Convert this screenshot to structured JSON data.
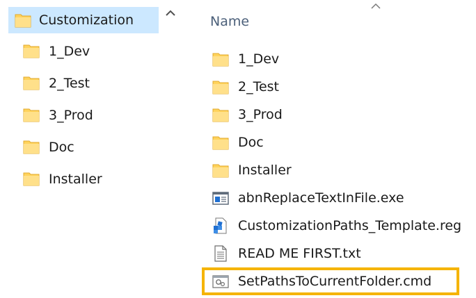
{
  "nav_pane": {
    "root": {
      "label": "Customization",
      "icon": "folder-icon"
    },
    "items": [
      {
        "label": "1_Dev",
        "icon": "folder-icon"
      },
      {
        "label": "2_Test",
        "icon": "folder-icon"
      },
      {
        "label": "3_Prod",
        "icon": "folder-icon"
      },
      {
        "label": "Doc",
        "icon": "folder-icon"
      },
      {
        "label": "Installer",
        "icon": "folder-icon"
      }
    ]
  },
  "content": {
    "column_header": "Name",
    "files": [
      {
        "label": "1_Dev",
        "icon": "folder-icon"
      },
      {
        "label": "2_Test",
        "icon": "folder-icon"
      },
      {
        "label": "3_Prod",
        "icon": "folder-icon"
      },
      {
        "label": "Doc",
        "icon": "folder-icon"
      },
      {
        "label": "Installer",
        "icon": "folder-icon"
      },
      {
        "label": "abnReplaceTextInFile.exe",
        "icon": "exe-icon"
      },
      {
        "label": "CustomizationPaths_Template.reg",
        "icon": "registry-icon"
      },
      {
        "label": "READ ME FIRST.txt",
        "icon": "text-file-icon"
      },
      {
        "label": "SetPathsToCurrentFolder.cmd",
        "icon": "cmd-script-icon"
      }
    ]
  },
  "colors": {
    "selection": "#cce8ff",
    "highlight_border": "#f5b400",
    "folder": "#ffd35c",
    "header_text": "#4c607a"
  }
}
